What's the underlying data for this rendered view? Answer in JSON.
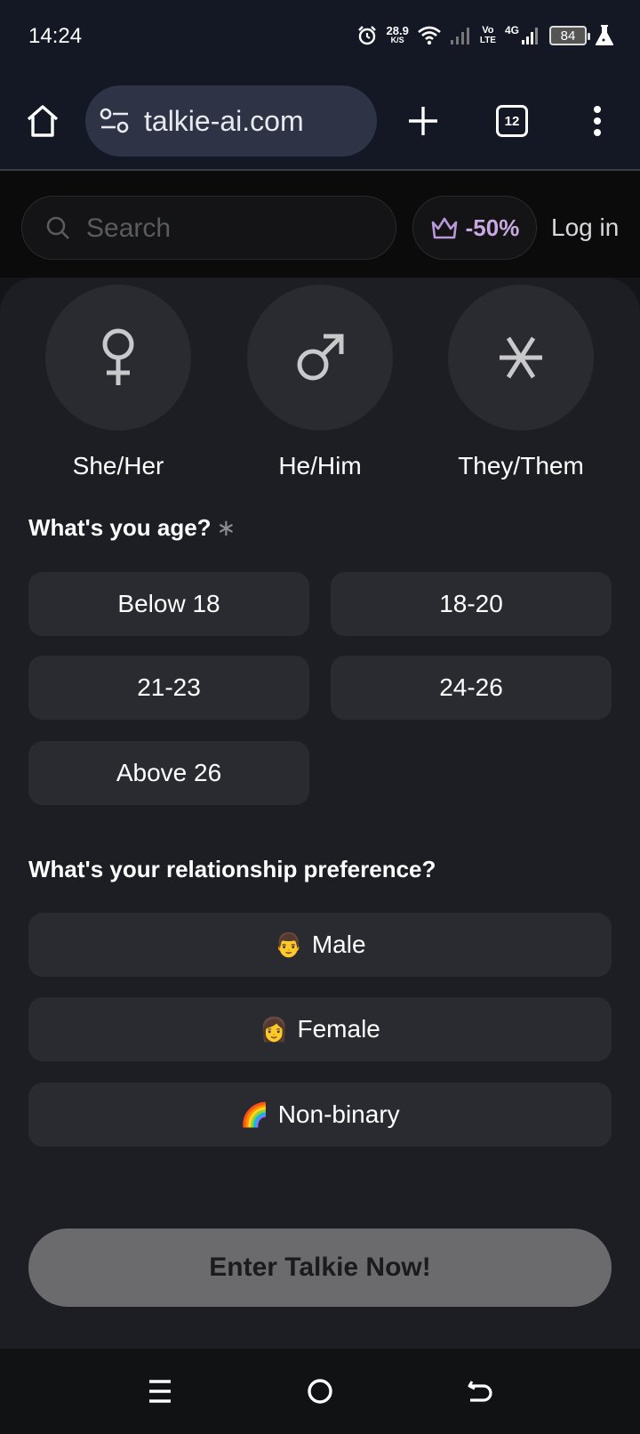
{
  "status_bar": {
    "time": "14:24",
    "net_speed_value": "28.9",
    "net_speed_unit": "K/S",
    "volte_top": "Vo",
    "volte_bottom": "LTE",
    "network_type": "4G",
    "battery": "84"
  },
  "browser": {
    "url": "talkie-ai.com",
    "tab_count": "12"
  },
  "site_header": {
    "search_placeholder": "Search",
    "promo_text": "-50%",
    "login_label": "Log in"
  },
  "pronouns": [
    {
      "label": "She/Her",
      "symbol": "♀"
    },
    {
      "label": "He/Him",
      "symbol": "♂"
    },
    {
      "label": "They/Them",
      "symbol": "⚹"
    }
  ],
  "age_question": {
    "label": "What's you age?",
    "required_mark": "∗",
    "options": [
      "Below 18",
      "18-20",
      "21-23",
      "24-26",
      "Above 26"
    ]
  },
  "relationship_question": {
    "label": "What's your relationship preference?",
    "options": [
      {
        "emoji": "👨",
        "label": "Male"
      },
      {
        "emoji": "👩",
        "label": "Female"
      },
      {
        "emoji": "🌈",
        "label": "Non-binary"
      }
    ]
  },
  "cta_label": "Enter Talkie Now!",
  "colors": {
    "sheet_bg": "#1d1e23",
    "option_bg": "#2a2b30",
    "cta_bg": "#6b6b6d",
    "promo_accent": "#c9a9e0",
    "url_pill_bg": "#2e3446"
  }
}
